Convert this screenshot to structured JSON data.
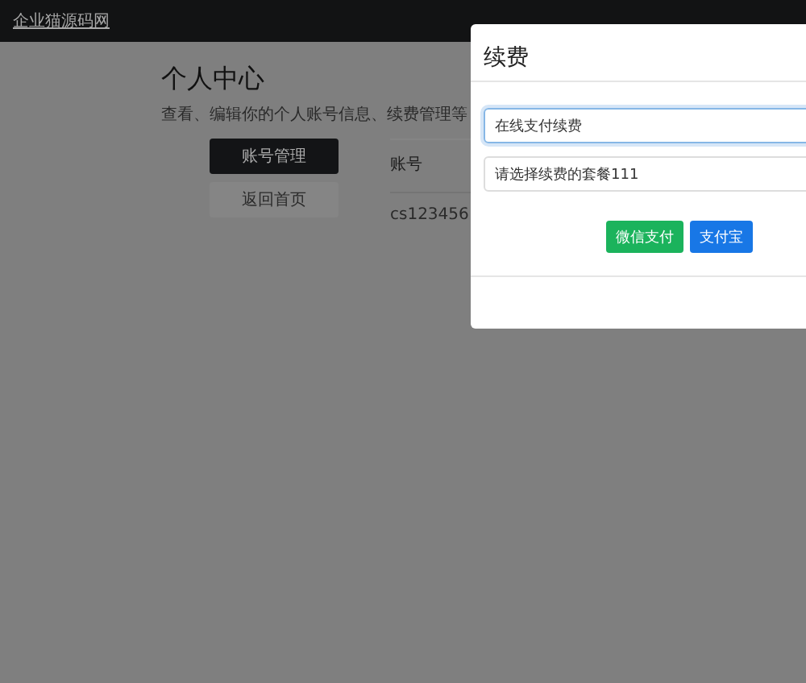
{
  "navbar": {
    "brand": "企业猫源码网"
  },
  "page": {
    "title": "个人中心",
    "subtitle": "查看、编辑你的个人账号信息、续费管理等"
  },
  "sidebar": {
    "items": [
      {
        "label": "账号管理",
        "selected": true
      },
      {
        "label": "返回首页",
        "selected": false
      }
    ]
  },
  "table": {
    "columns": [
      "账号"
    ],
    "rows": [
      [
        "cs123456"
      ]
    ]
  },
  "modal": {
    "title": "续费",
    "fields": [
      {
        "value": "在线支付续费",
        "focused": true
      },
      {
        "value": "请选择续费的套餐111",
        "focused": false
      }
    ],
    "buttons": [
      {
        "label": "微信支付",
        "color": "#1bb35c"
      },
      {
        "label": "支付宝",
        "color": "#1877e6"
      }
    ]
  }
}
